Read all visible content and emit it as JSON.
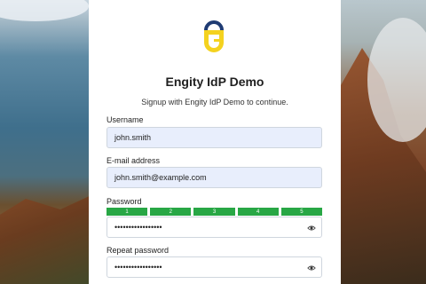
{
  "app": {
    "title": "Engity IdP Demo",
    "subtitle": "Signup with Engity IdP Demo to continue."
  },
  "form": {
    "username": {
      "label": "Username",
      "value": "john.smith"
    },
    "email": {
      "label": "E-mail address",
      "value": "john.smith@example.com"
    },
    "password": {
      "label": "Password",
      "value": "•••••••••••••••••"
    },
    "password_strength": {
      "levels": [
        "1",
        "2",
        "3",
        "4",
        "5"
      ],
      "filled": 5,
      "color": "#28a745"
    },
    "repeat_password": {
      "label": "Repeat password",
      "value": "•••••••••••••••••"
    }
  },
  "icons": {
    "logo": "engity-logo",
    "visibility": "eye-icon"
  },
  "colors": {
    "logo_yellow": "#f4d21f",
    "logo_navy": "#1f3b73",
    "field_fill": "#e8eefc"
  }
}
